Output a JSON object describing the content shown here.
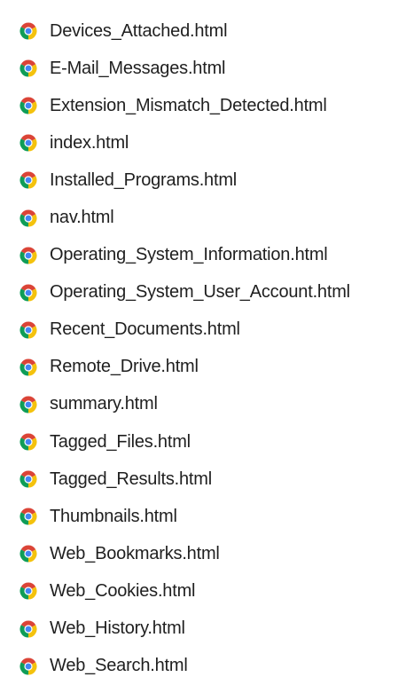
{
  "files": [
    {
      "name": "Devices_Attached.html",
      "icon": "chrome-icon"
    },
    {
      "name": "E-Mail_Messages.html",
      "icon": "chrome-icon"
    },
    {
      "name": "Extension_Mismatch_Detected.html",
      "icon": "chrome-icon"
    },
    {
      "name": "index.html",
      "icon": "chrome-icon"
    },
    {
      "name": "Installed_Programs.html",
      "icon": "chrome-icon"
    },
    {
      "name": "nav.html",
      "icon": "chrome-icon"
    },
    {
      "name": "Operating_System_Information.html",
      "icon": "chrome-icon"
    },
    {
      "name": "Operating_System_User_Account.html",
      "icon": "chrome-icon"
    },
    {
      "name": "Recent_Documents.html",
      "icon": "chrome-icon"
    },
    {
      "name": "Remote_Drive.html",
      "icon": "chrome-icon"
    },
    {
      "name": "summary.html",
      "icon": "chrome-icon"
    },
    {
      "name": "Tagged_Files.html",
      "icon": "chrome-icon"
    },
    {
      "name": "Tagged_Results.html",
      "icon": "chrome-icon"
    },
    {
      "name": "Thumbnails.html",
      "icon": "chrome-icon"
    },
    {
      "name": "Web_Bookmarks.html",
      "icon": "chrome-icon"
    },
    {
      "name": "Web_Cookies.html",
      "icon": "chrome-icon"
    },
    {
      "name": "Web_History.html",
      "icon": "chrome-icon"
    },
    {
      "name": "Web_Search.html",
      "icon": "chrome-icon"
    }
  ],
  "colors": {
    "chrome_red": "#db4437",
    "chrome_yellow": "#f4c20d",
    "chrome_green": "#0f9d58",
    "chrome_blue": "#4285f4",
    "text": "#1f1f1f"
  }
}
